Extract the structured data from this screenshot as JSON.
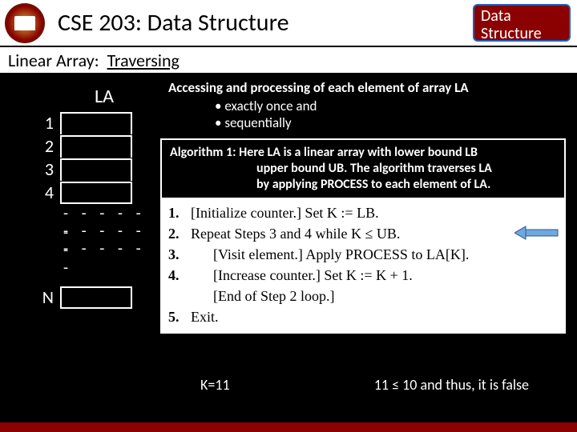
{
  "header": {
    "title": "CSE 203: Data Structure",
    "badge_line1": "Data",
    "badge_line2": "Structure"
  },
  "subhead": {
    "label": "Linear Array:",
    "value": "Traversing"
  },
  "array": {
    "la_label": "LA",
    "indices": [
      "1",
      "2",
      "3",
      "4"
    ],
    "dash": "- - - - - -",
    "last_index": "N"
  },
  "definition": {
    "line1": "Accessing and processing of each element of array LA",
    "bullets": [
      "exactly once and",
      "sequentially"
    ]
  },
  "algorithm": {
    "heading_l1": "Algorithm 1: Here LA is a linear array with lower bound LB",
    "heading_l2": "upper bound UB. The algorithm traverses LA",
    "heading_l3": "by applying PROCESS to each element of LA.",
    "steps": {
      "s1": "[Initialize counter.] Set K := LB.",
      "s2": "Repeat Steps 3 and 4 while K ≤ UB.",
      "s3": "[Visit element.] Apply PROCESS to LA[K].",
      "s4": "[Increase counter.] Set K := K + 1.",
      "s4b": "[End of Step 2 loop.]",
      "s5": "Exit."
    }
  },
  "footer_calc": {
    "k": "K=11",
    "cond": "11 ≤ 10 and thus, it is false"
  }
}
